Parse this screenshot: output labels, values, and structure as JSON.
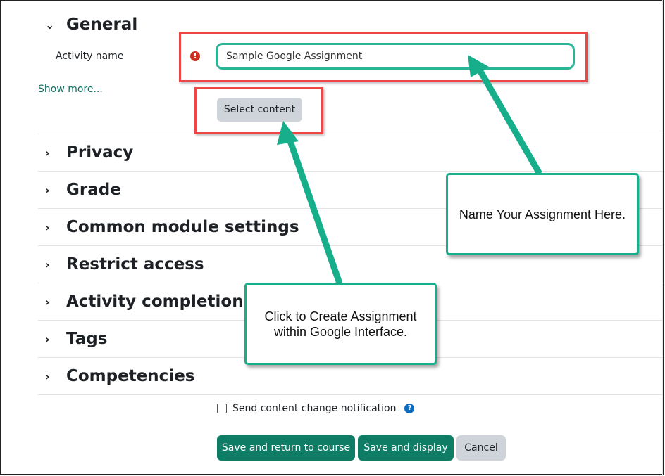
{
  "form": {
    "general": {
      "title": "General",
      "activity_name_label": "Activity name",
      "activity_name_value": "Sample Google Assignment",
      "required_icon": "exclamation-circle-icon",
      "show_more": "Show more...",
      "select_content_label": "Select content"
    },
    "sections": [
      {
        "title": "Privacy"
      },
      {
        "title": "Grade"
      },
      {
        "title": "Common module settings"
      },
      {
        "title": "Restrict access"
      },
      {
        "title": "Activity completion"
      },
      {
        "title": "Tags"
      },
      {
        "title": "Competencies"
      }
    ],
    "notification_checkbox": {
      "label": "Send content change notification",
      "checked": false,
      "help_icon": "question-circle-icon"
    },
    "buttons": {
      "save_return": "Save and return to course",
      "save_display": "Save and display",
      "cancel": "Cancel"
    }
  },
  "annotations": {
    "callout_name": "Name Your Assignment Here.",
    "callout_create_line1": "Click to Create Assignment",
    "callout_create_line2": "within Google Interface."
  },
  "colors": {
    "accent_green": "#0f7d66",
    "callout_teal": "#17ae8c",
    "highlight_red": "#ee4545",
    "required_red": "#ca3120"
  }
}
